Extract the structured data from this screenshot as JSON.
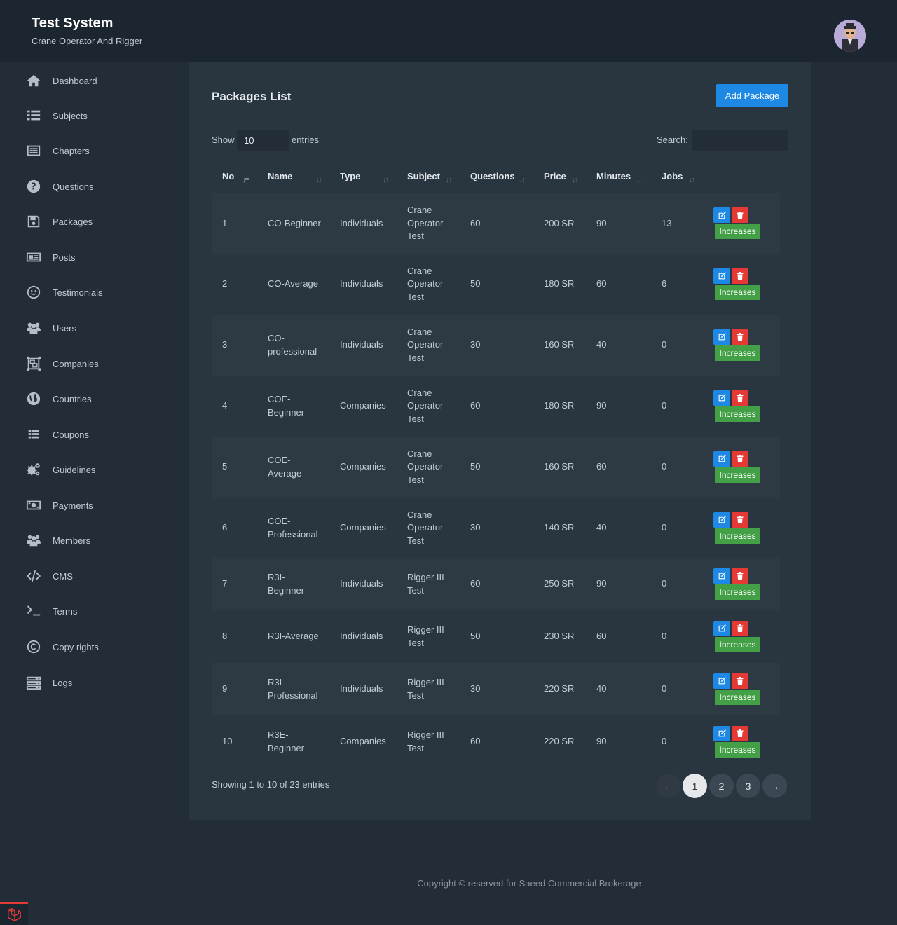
{
  "header": {
    "title": "Test System",
    "subtitle": "Crane Operator And Rigger"
  },
  "sidebar": {
    "items": [
      {
        "label": "Dashboard",
        "icon": "home-icon"
      },
      {
        "label": "Subjects",
        "icon": "list-icon"
      },
      {
        "label": "Chapters",
        "icon": "newspaper-list-icon"
      },
      {
        "label": "Questions",
        "icon": "question-circle-icon"
      },
      {
        "label": "Packages",
        "icon": "floppy-disk-icon"
      },
      {
        "label": "Posts",
        "icon": "newspaper-icon"
      },
      {
        "label": "Testimonials",
        "icon": "smile-icon"
      },
      {
        "label": "Users",
        "icon": "users-icon"
      },
      {
        "label": "Companies",
        "icon": "object-group-icon"
      },
      {
        "label": "Countries",
        "icon": "globe-icon"
      },
      {
        "label": "Coupons",
        "icon": "list-alt-icon"
      },
      {
        "label": "Guidelines",
        "icon": "gears-icon"
      },
      {
        "label": "Payments",
        "icon": "money-bill-icon"
      },
      {
        "label": "Members",
        "icon": "users-group-icon"
      },
      {
        "label": "CMS",
        "icon": "code-icon"
      },
      {
        "label": "Terms",
        "icon": "terminal-icon"
      },
      {
        "label": "Copy rights",
        "icon": "copyright-icon"
      },
      {
        "label": "Logs",
        "icon": "server-icon"
      }
    ]
  },
  "main": {
    "title": "Packages List",
    "add_button": "Add Package",
    "show_label": "Show",
    "show_value": "10",
    "entries_label": "entries",
    "search_label": "Search:",
    "search_value": "",
    "columns": [
      "No",
      "Name",
      "Type",
      "Subject",
      "Questions",
      "Price",
      "Minutes",
      "Jobs"
    ],
    "rows": [
      {
        "no": "1",
        "name": [
          "CO-Beginner"
        ],
        "type": "Individuals",
        "subject": [
          "Crane",
          "Operator",
          "Test"
        ],
        "questions": "60",
        "price": "200 SR",
        "minutes": "90",
        "jobs": "13"
      },
      {
        "no": "2",
        "name": [
          "CO-Average"
        ],
        "type": "Individuals",
        "subject": [
          "Crane",
          "Operator",
          "Test"
        ],
        "questions": "50",
        "price": "180 SR",
        "minutes": "60",
        "jobs": "6"
      },
      {
        "no": "3",
        "name": [
          "CO-",
          "professional"
        ],
        "type": "Individuals",
        "subject": [
          "Crane",
          "Operator",
          "Test"
        ],
        "questions": "30",
        "price": "160 SR",
        "minutes": "40",
        "jobs": "0"
      },
      {
        "no": "4",
        "name": [
          "COE-",
          "Beginner"
        ],
        "type": "Companies",
        "subject": [
          "Crane",
          "Operator",
          "Test"
        ],
        "questions": "60",
        "price": "180 SR",
        "minutes": "90",
        "jobs": "0"
      },
      {
        "no": "5",
        "name": [
          "COE-",
          "Average"
        ],
        "type": "Companies",
        "subject": [
          "Crane",
          "Operator",
          "Test"
        ],
        "questions": "50",
        "price": "160 SR",
        "minutes": "60",
        "jobs": "0"
      },
      {
        "no": "6",
        "name": [
          "COE-",
          "Professional"
        ],
        "type": "Companies",
        "subject": [
          "Crane",
          "Operator",
          "Test"
        ],
        "questions": "30",
        "price": "140 SR",
        "minutes": "40",
        "jobs": "0"
      },
      {
        "no": "7",
        "name": [
          "R3I-",
          "Beginner"
        ],
        "type": "Individuals",
        "subject": [
          "Rigger III",
          "Test"
        ],
        "questions": "60",
        "price": "250 SR",
        "minutes": "90",
        "jobs": "0"
      },
      {
        "no": "8",
        "name": [
          "R3I-Average"
        ],
        "type": "Individuals",
        "subject": [
          "Rigger III",
          "Test"
        ],
        "questions": "50",
        "price": "230 SR",
        "minutes": "60",
        "jobs": "0"
      },
      {
        "no": "9",
        "name": [
          "R3I-",
          "Professional"
        ],
        "type": "Individuals",
        "subject": [
          "Rigger III",
          "Test"
        ],
        "questions": "30",
        "price": "220 SR",
        "minutes": "40",
        "jobs": "0"
      },
      {
        "no": "10",
        "name": [
          "R3E-",
          "Beginner"
        ],
        "type": "Companies",
        "subject": [
          "Rigger III",
          "Test"
        ],
        "questions": "60",
        "price": "220 SR",
        "minutes": "90",
        "jobs": "0"
      }
    ],
    "increase_label": "Increases",
    "showing_text": "Showing 1 to 10 of 23 entries",
    "pagination": {
      "prev": "←",
      "pages": [
        "1",
        "2",
        "3"
      ],
      "active": "1",
      "next": "→"
    }
  },
  "footer": {
    "text": "Copyright © reserved for Saeed Commercial Brokerage"
  },
  "colors": {
    "primary": "#1e88e5",
    "danger": "#e53935",
    "success": "#43a047",
    "background": "#222d37",
    "panel": "#29353f"
  }
}
